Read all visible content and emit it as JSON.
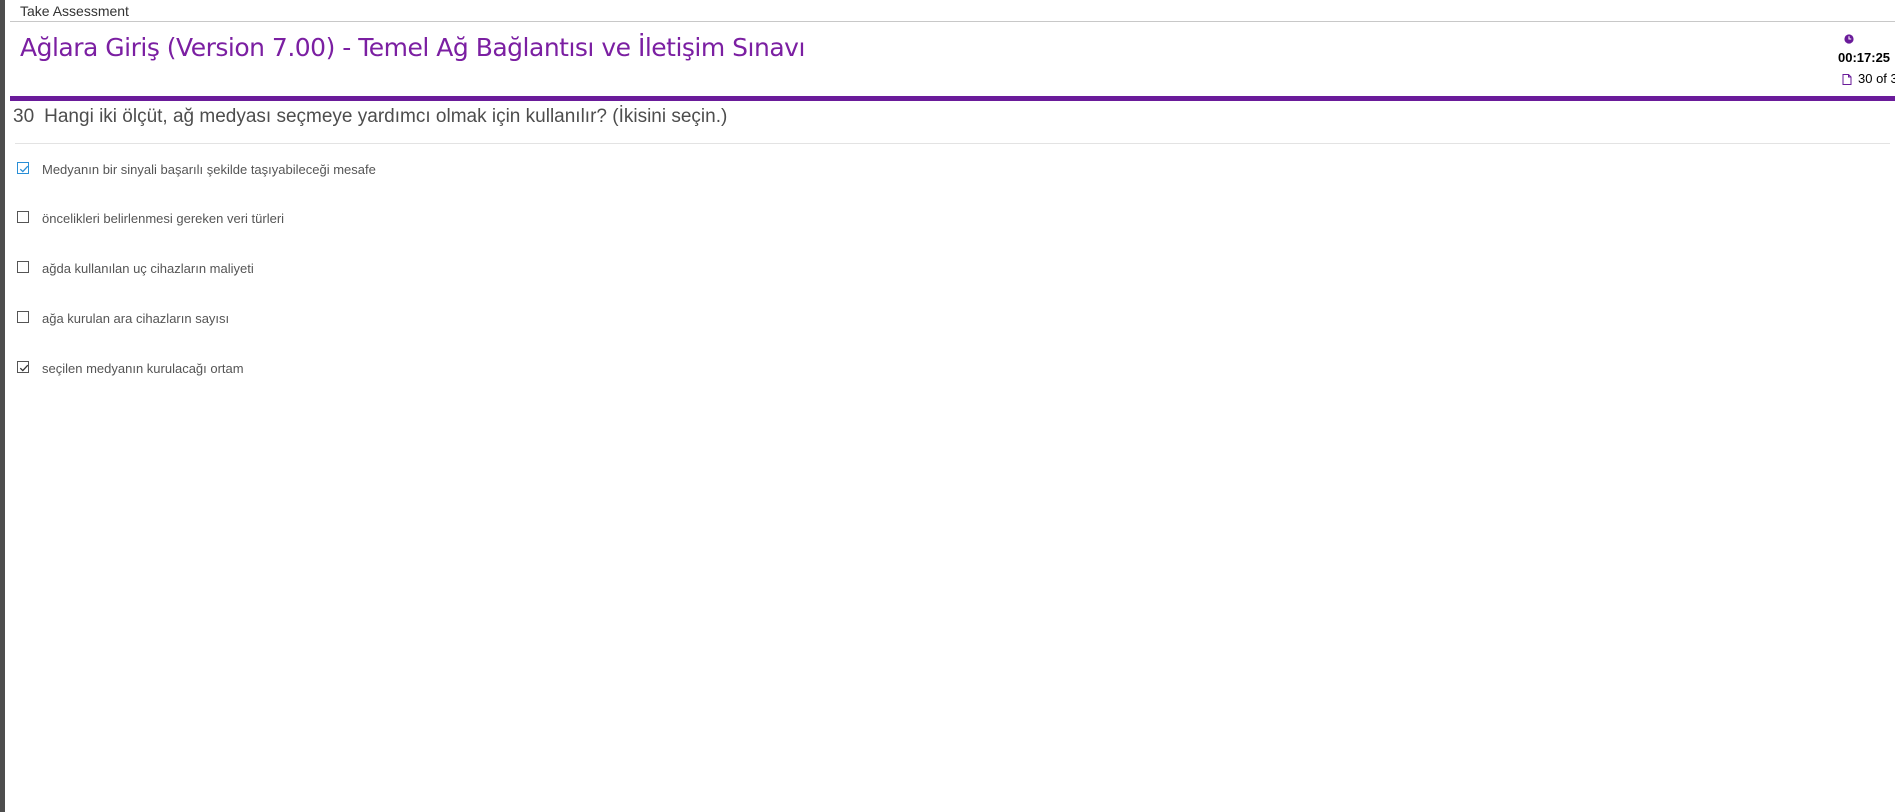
{
  "window": {
    "title": "Take Assessment"
  },
  "header": {
    "exam_title": "Ağlara Giriş (Version 7.00) - Temel Ağ Bağlantısı ve İletişim Sınavı",
    "timer": "00:17:25",
    "progress": "30 of 3"
  },
  "question": {
    "number": "30",
    "text": "Hangi iki ölçüt, ağ medyası seçmeye yardımcı olmak için kullanılır? (İkisini seçin.)",
    "options": [
      {
        "label": "Medyanın bir sinyali başarılı şekilde taşıyabileceği mesafe",
        "checked": true
      },
      {
        "label": "öncelikleri belirlenmesi gereken veri türleri",
        "checked": false
      },
      {
        "label": "ağda kullanılan uç cihazların maliyeti",
        "checked": false
      },
      {
        "label": "ağa kurulan ara cihazların sayısı",
        "checked": false
      },
      {
        "label": "seçilen medyanın kurulacağı ortam",
        "checked": true
      }
    ]
  },
  "colors": {
    "accent": "#6a1b9a",
    "title": "#7b1fa2",
    "focus": "#2a8fd6"
  },
  "icons": {
    "timer": "clock-icon",
    "progress": "page-icon",
    "checked": "checkmark-icon"
  }
}
